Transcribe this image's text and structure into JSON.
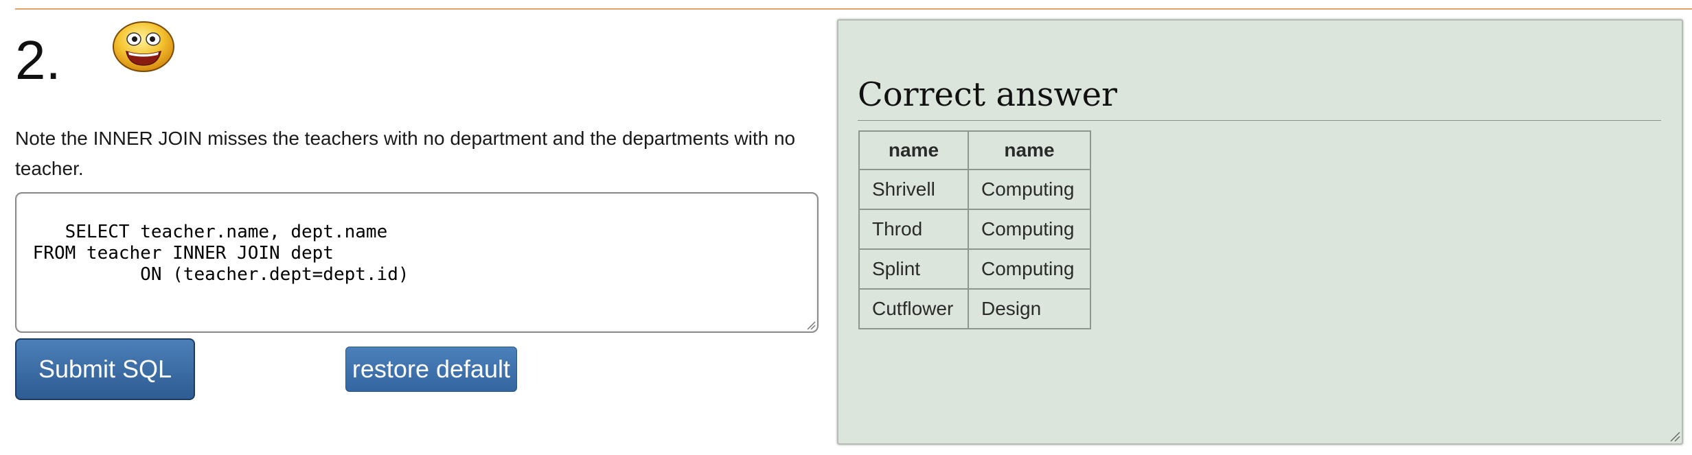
{
  "question": {
    "number": "2.",
    "icon": "smiley-face-icon",
    "note": "Note the INNER JOIN misses the teachers with no department and the departments with no teacher."
  },
  "editor": {
    "sql": "SELECT teacher.name, dept.name\n FROM teacher INNER JOIN dept\n           ON (teacher.dept=dept.id)"
  },
  "buttons": {
    "submit_label": "Submit SQL",
    "restore_label": "restore default"
  },
  "answer": {
    "title": "Correct answer",
    "columns": [
      "name",
      "name"
    ],
    "rows": [
      [
        "Shrivell",
        "Computing"
      ],
      [
        "Throd",
        "Computing"
      ],
      [
        "Splint",
        "Computing"
      ],
      [
        "Cutflower",
        "Design"
      ]
    ]
  },
  "colors": {
    "accent_rule": "#e0a264",
    "button_blue": "#3466a0",
    "panel_bg": "#dce5db"
  }
}
